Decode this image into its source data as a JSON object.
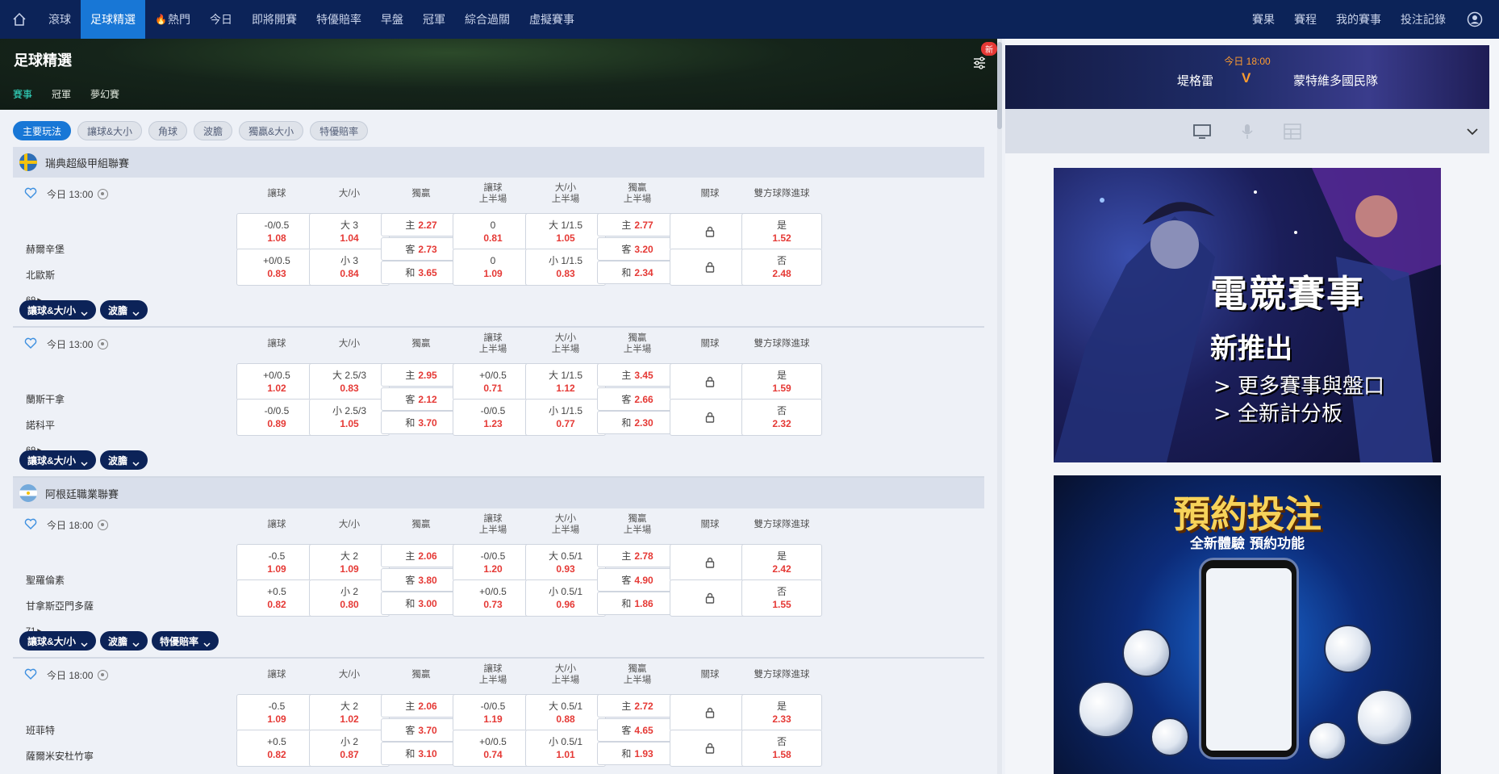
{
  "nav": {
    "items": [
      "滾球",
      "足球精選",
      "熱門",
      "今日",
      "即將開賽",
      "特優賠率",
      "早盤",
      "冠軍",
      "綜合過關",
      "虛擬賽事"
    ],
    "active_index": 1,
    "right_items": [
      "賽果",
      "賽程",
      "我的賽事",
      "投注記錄"
    ]
  },
  "hero": {
    "title": "足球精選",
    "tabs": [
      "賽事",
      "冠軍",
      "夢幻賽"
    ],
    "badge": "新"
  },
  "chips": [
    "主要玩法",
    "讓球&大小",
    "角球",
    "波膽",
    "獨贏&大小",
    "特優賠率"
  ],
  "columns": [
    "讓球",
    "大/小",
    "獨贏",
    "讓球\n上半場",
    "大/小\n上半場",
    "獨贏\n上半場",
    "關球",
    "雙方球隊進球"
  ],
  "leagues": [
    {
      "name": "瑞典超級甲組聯賽",
      "flag": "sweden",
      "matches": [
        {
          "time": "今日 13:00",
          "home": "赫爾辛堡",
          "away": "北歐斯",
          "more": "69",
          "hdp": [
            {
              "line": "-0/0.5",
              "odd": "1.08"
            },
            {
              "line": "+0/0.5",
              "odd": "0.83"
            }
          ],
          "ou": [
            {
              "line": "大 3",
              "odd": "1.04"
            },
            {
              "line": "小 3",
              "odd": "0.84"
            }
          ],
          "x12": [
            {
              "line": "主",
              "odd": "2.27"
            },
            {
              "line": "客",
              "odd": "2.73"
            },
            {
              "line": "和",
              "odd": "3.65"
            }
          ],
          "hdp1h": [
            {
              "line": "0",
              "odd": "0.81"
            },
            {
              "line": "0",
              "odd": "1.09"
            }
          ],
          "ou1h": [
            {
              "line": "大 1/1.5",
              "odd": "1.05"
            },
            {
              "line": "小 1/1.5",
              "odd": "0.83"
            }
          ],
          "x121h": [
            {
              "line": "主",
              "odd": "2.77"
            },
            {
              "line": "客",
              "odd": "3.20"
            },
            {
              "line": "和",
              "odd": "2.34"
            }
          ],
          "btts": [
            {
              "line": "是",
              "odd": "1.52"
            },
            {
              "line": "否",
              "odd": "2.48"
            }
          ],
          "tags": [
            "讓球&大/小",
            "波膽"
          ]
        },
        {
          "time": "今日 13:00",
          "home": "蘭斯干拿",
          "away": "諾科平",
          "more": "69",
          "hdp": [
            {
              "line": "+0/0.5",
              "odd": "1.02"
            },
            {
              "line": "-0/0.5",
              "odd": "0.89"
            }
          ],
          "ou": [
            {
              "line": "大 2.5/3",
              "odd": "0.83"
            },
            {
              "line": "小 2.5/3",
              "odd": "1.05"
            }
          ],
          "x12": [
            {
              "line": "主",
              "odd": "2.95"
            },
            {
              "line": "客",
              "odd": "2.12"
            },
            {
              "line": "和",
              "odd": "3.70"
            }
          ],
          "hdp1h": [
            {
              "line": "+0/0.5",
              "odd": "0.71"
            },
            {
              "line": "-0/0.5",
              "odd": "1.23"
            }
          ],
          "ou1h": [
            {
              "line": "大 1/1.5",
              "odd": "1.12"
            },
            {
              "line": "小 1/1.5",
              "odd": "0.77"
            }
          ],
          "x121h": [
            {
              "line": "主",
              "odd": "3.45"
            },
            {
              "line": "客",
              "odd": "2.66"
            },
            {
              "line": "和",
              "odd": "2.30"
            }
          ],
          "btts": [
            {
              "line": "是",
              "odd": "1.59"
            },
            {
              "line": "否",
              "odd": "2.32"
            }
          ],
          "tags": [
            "讓球&大/小",
            "波膽"
          ]
        }
      ]
    },
    {
      "name": "阿根廷職業聯賽",
      "flag": "argentina",
      "matches": [
        {
          "time": "今日 18:00",
          "home": "聖羅倫素",
          "away": "甘拿斯亞門多薩",
          "more": "71",
          "hdp": [
            {
              "line": "-0.5",
              "odd": "1.09"
            },
            {
              "line": "+0.5",
              "odd": "0.82"
            }
          ],
          "ou": [
            {
              "line": "大 2",
              "odd": "1.09"
            },
            {
              "line": "小 2",
              "odd": "0.80"
            }
          ],
          "x12": [
            {
              "line": "主",
              "odd": "2.06"
            },
            {
              "line": "客",
              "odd": "3.80"
            },
            {
              "line": "和",
              "odd": "3.00"
            }
          ],
          "hdp1h": [
            {
              "line": "-0/0.5",
              "odd": "1.20"
            },
            {
              "line": "+0/0.5",
              "odd": "0.73"
            }
          ],
          "ou1h": [
            {
              "line": "大 0.5/1",
              "odd": "0.93"
            },
            {
              "line": "小 0.5/1",
              "odd": "0.96"
            }
          ],
          "x121h": [
            {
              "line": "主",
              "odd": "2.78"
            },
            {
              "line": "客",
              "odd": "4.90"
            },
            {
              "line": "和",
              "odd": "1.86"
            }
          ],
          "btts": [
            {
              "line": "是",
              "odd": "2.42"
            },
            {
              "line": "否",
              "odd": "1.55"
            }
          ],
          "tags": [
            "讓球&大/小",
            "波膽",
            "特優賠率"
          ]
        },
        {
          "time": "今日 18:00",
          "home": "班菲特",
          "away": "薩爾米安杜竹寧",
          "more": "71",
          "hdp": [
            {
              "line": "-0.5",
              "odd": "1.09"
            },
            {
              "line": "+0.5",
              "odd": "0.82"
            }
          ],
          "ou": [
            {
              "line": "大 2",
              "odd": "1.02"
            },
            {
              "line": "小 2",
              "odd": "0.87"
            }
          ],
          "x12": [
            {
              "line": "主",
              "odd": "2.06"
            },
            {
              "line": "客",
              "odd": "3.70"
            },
            {
              "line": "和",
              "odd": "3.10"
            }
          ],
          "hdp1h": [
            {
              "line": "-0/0.5",
              "odd": "1.19"
            },
            {
              "line": "+0/0.5",
              "odd": "0.74"
            }
          ],
          "ou1h": [
            {
              "line": "大 0.5/1",
              "odd": "0.88"
            },
            {
              "line": "小 0.5/1",
              "odd": "1.01"
            }
          ],
          "x121h": [
            {
              "line": "主",
              "odd": "2.72"
            },
            {
              "line": "客",
              "odd": "4.65"
            },
            {
              "line": "和",
              "odd": "1.93"
            }
          ],
          "btts": [
            {
              "line": "是",
              "odd": "2.33"
            },
            {
              "line": "否",
              "odd": "1.58"
            }
          ],
          "tags": []
        }
      ]
    }
  ],
  "live": {
    "time": "今日 18:00",
    "home": "堤格雷",
    "vs": "V",
    "away": "蒙特維多國民隊"
  },
  "banners": {
    "esports": {
      "title": "電競賽事",
      "subtitle": "新推出",
      "lines": [
        "> 更多賽事與盤口",
        "> 全新計分板"
      ]
    },
    "booking": {
      "title": "預約投注",
      "subtitle": "全新體驗 預約功能"
    }
  },
  "colors": {
    "nav_bg": "#0c2358",
    "accent": "#1877d6",
    "odds": "#e53935",
    "live_time": "#ff9c2e"
  }
}
